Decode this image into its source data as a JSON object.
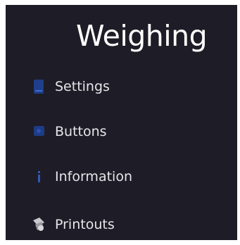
{
  "header": {
    "title": "Weighing"
  },
  "menu": {
    "items": [
      {
        "label": "Settings",
        "icon": "settings-icon"
      },
      {
        "label": "Buttons",
        "icon": "buttons-icon"
      },
      {
        "label": "Information",
        "icon": "information-icon"
      },
      {
        "label": "Printouts",
        "icon": "printouts-icon"
      }
    ]
  },
  "colors": {
    "background": "#1e1c26",
    "text": "#e6e6ea",
    "icon_blue": "#1f3f8a"
  }
}
